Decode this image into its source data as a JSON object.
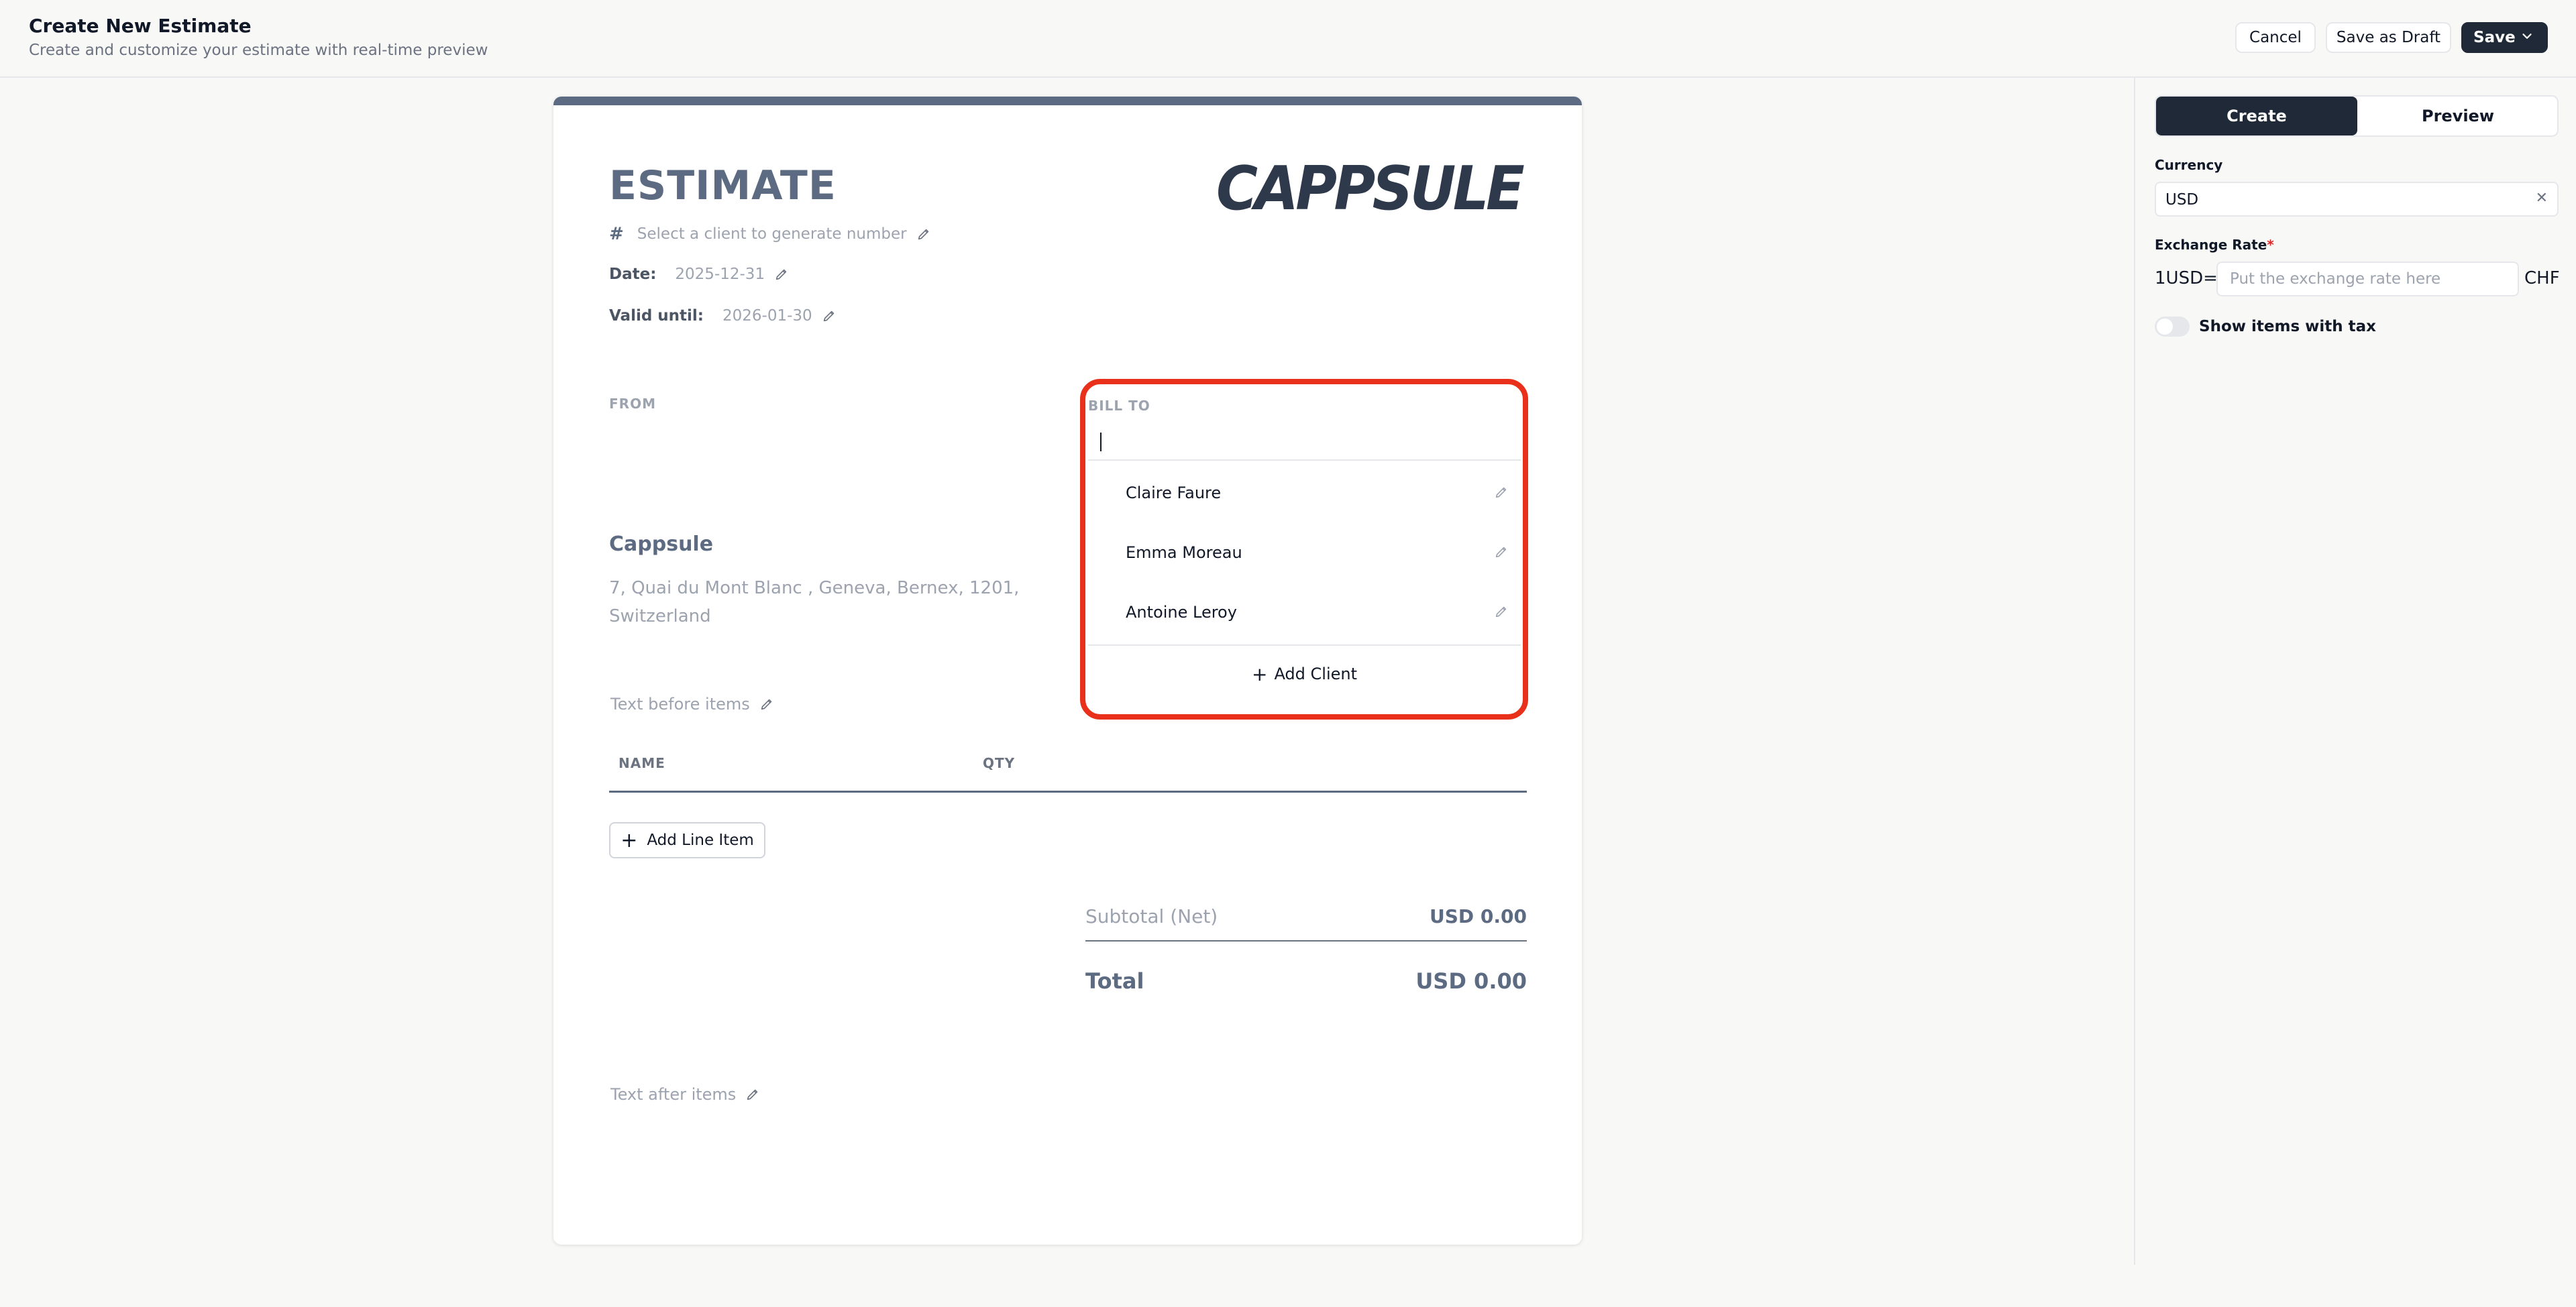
{
  "header": {
    "title": "Create New Estimate",
    "subtitle": "Create and customize your estimate with real-time preview",
    "cancel_label": "Cancel",
    "draft_label": "Save as Draft",
    "save_label": "Save"
  },
  "document": {
    "heading": "ESTIMATE",
    "logo_text": "CAPPSULE",
    "number_placeholder": "Select a client to generate number",
    "date_label": "Date:",
    "date_value": "2025-12-31",
    "valid_label": "Valid until:",
    "valid_value": "2026-01-30",
    "from_label": "FROM",
    "from_name": "Cappsule",
    "from_address": "7, Quai du Mont Blanc , Geneva, Bernex, 1201, Switzerland",
    "text_before": "Text before items",
    "columns": [
      "NAME",
      "QTY"
    ],
    "add_line_label": "Add Line Item",
    "subtotal_label": "Subtotal (Net)",
    "subtotal_value": "USD 0.00",
    "total_label": "Total",
    "total_value": "USD 0.00",
    "text_after": "Text after items"
  },
  "bill_to": {
    "label": "BILL TO",
    "search_value": "",
    "clients": [
      "Claire Faure",
      "Emma Moreau",
      "Antoine Leroy"
    ],
    "add_client_label": "Add Client"
  },
  "sidebar": {
    "tabs": [
      "Create",
      "Preview"
    ],
    "active_tab": "Create",
    "currency_label": "Currency",
    "currency_value": "USD",
    "rate_label": "Exchange Rate",
    "rate_required": "*",
    "rate_prefix": "1USD=",
    "rate_placeholder": "Put the exchange rate here",
    "rate_suffix": "CHF",
    "tax_toggle_label": "Show items with tax",
    "tax_toggle_on": false
  },
  "colors": {
    "accent": "#1f2937",
    "doc_accent": "#5c6b81",
    "highlight": "#e8301b"
  }
}
